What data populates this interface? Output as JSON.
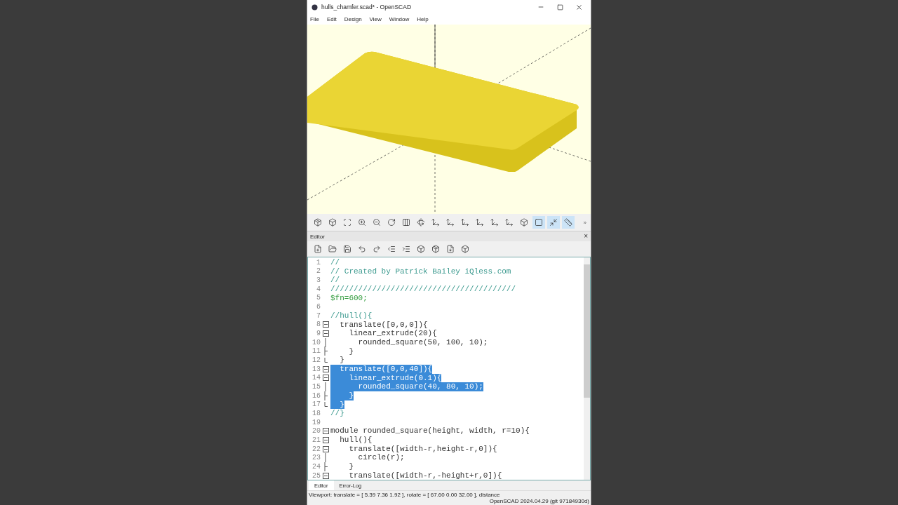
{
  "window": {
    "title": "hulls_chamfer.scad* - OpenSCAD"
  },
  "menu": [
    "File",
    "Edit",
    "Design",
    "View",
    "Window",
    "Help"
  ],
  "viewer_toolbar": {
    "buttons": [
      {
        "selected": false
      },
      {
        "selected": false
      },
      {
        "selected": false
      },
      {
        "selected": false
      },
      {
        "selected": false
      },
      {
        "selected": false
      },
      {
        "selected": false
      },
      {
        "selected": false
      },
      {
        "selected": false
      },
      {
        "selected": false
      },
      {
        "selected": false
      },
      {
        "selected": false
      },
      {
        "selected": false
      },
      {
        "selected": false
      },
      {
        "selected": false
      },
      {
        "selected": true
      },
      {
        "selected": true
      },
      {
        "selected": true
      }
    ],
    "overflow": "»"
  },
  "editor": {
    "title": "Editor",
    "close": "×",
    "lines": [
      {
        "number": "1",
        "text": "//",
        "kind": "comment",
        "selected": false
      },
      {
        "number": "2",
        "text": "// Created by Patrick Bailey iQless.com",
        "kind": "comment",
        "selected": false
      },
      {
        "number": "3",
        "text": "//",
        "kind": "comment",
        "selected": false
      },
      {
        "number": "4",
        "text": "////////////////////////////////////////",
        "kind": "comment",
        "selected": false
      },
      {
        "number": "5",
        "text": "$fn=600;",
        "kind": "special",
        "selected": false
      },
      {
        "number": "6"
      },
      {
        "number": "7",
        "text": "//hull(){",
        "kind": "comment",
        "selected": false
      },
      {
        "number": "8",
        "text": "  translate([0,0,0]){",
        "kind": "code",
        "expanded": true,
        "selected": false
      },
      {
        "number": "9",
        "text": "    linear_extrude(20){",
        "kind": "code",
        "expanded": true,
        "selected": false
      },
      {
        "number": "10",
        "text": "      rounded_square(50, 100, 10);",
        "kind": "code",
        "selected": false
      },
      {
        "number": "11",
        "text": "    }",
        "kind": "code",
        "selected": false
      },
      {
        "number": "12",
        "text": "  }",
        "kind": "code",
        "selected": false
      },
      {
        "number": "13",
        "text": "  translate([0,0,40]){",
        "kind": "code",
        "expanded": true,
        "selected": true
      },
      {
        "number": "14",
        "text": "    linear_extrude(0.1){",
        "kind": "code",
        "expanded": true,
        "selected": true
      },
      {
        "number": "15",
        "text": "      rounded_square(40, 80, 10);",
        "kind": "code",
        "selected": true
      },
      {
        "number": "16",
        "text": "    }",
        "kind": "code",
        "selected": true
      },
      {
        "number": "17",
        "text": "  }",
        "kind": "code",
        "selected": true
      },
      {
        "number": "18",
        "text": "//}",
        "kind": "comment",
        "selected": false
      },
      {
        "number": "19"
      },
      {
        "number": "20",
        "text": "module rounded_square(height, width, r=10){",
        "kind": "code",
        "expanded": true,
        "selected": false
      },
      {
        "number": "21",
        "text": "  hull(){",
        "kind": "code",
        "expanded": true,
        "selected": false
      },
      {
        "number": "22",
        "text": "    translate([width-r,height-r,0]){",
        "kind": "code",
        "expanded": true,
        "selected": false
      },
      {
        "number": "23",
        "text": "      circle(r);",
        "kind": "code",
        "selected": false
      },
      {
        "number": "24",
        "text": "    }",
        "kind": "code",
        "selected": false
      },
      {
        "number": "25",
        "text": "    translate([width-r,-height+r,0]){",
        "kind": "code",
        "expanded": true,
        "selected": false
      }
    ]
  },
  "tabs": [
    {
      "label": "Editor",
      "selected": true
    },
    {
      "label": "Error-Log",
      "selected": false
    }
  ],
  "status_bar": {
    "viewport": "Viewport: translate = [ 5.39 7.36 1.92 ], rotate = [ 67.60 0.00 32.00 ], distance",
    "version": "OpenSCAD 2024.04.29 (git 97184930d)"
  }
}
